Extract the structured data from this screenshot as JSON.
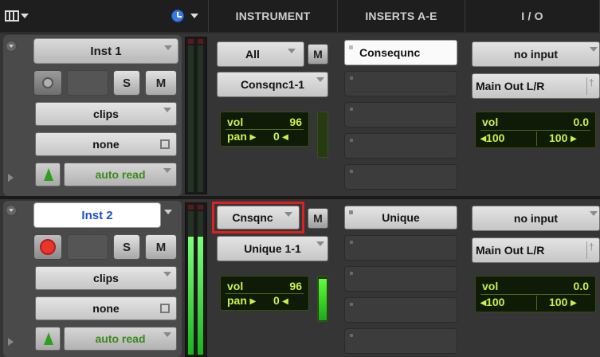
{
  "header": {
    "instrument": "INSTRUMENT",
    "inserts": "INSERTS A-E",
    "io": "I / O"
  },
  "tracks": [
    {
      "name": "Inst 1",
      "name_selected": false,
      "record_armed": false,
      "solo_label": "S",
      "mute_label": "M",
      "playlist": "clips",
      "group": "none",
      "automation": "auto read",
      "instrument_midi_in": "All",
      "instrument_midi_out": "Consqnc1-1",
      "instrument_m_label": "M",
      "vol_label": "vol",
      "vol_value": "96",
      "pan_label": "pan",
      "pan_value": "0",
      "insert_a": "Consequnc",
      "io_input": "no input",
      "io_output": "Main Out L/R",
      "io_vol_label": "vol",
      "io_vol_value": "0.0",
      "io_pan_left": "100",
      "io_pan_right": "100",
      "meter_level": 0
    },
    {
      "name": "Inst 2",
      "name_selected": true,
      "record_armed": true,
      "solo_label": "S",
      "mute_label": "M",
      "playlist": "clips",
      "group": "none",
      "automation": "auto read",
      "instrument_midi_in": "Cnsqnc",
      "instrument_midi_out": "Unique 1-1",
      "instrument_m_label": "M",
      "vol_label": "vol",
      "vol_value": "96",
      "pan_label": "pan",
      "pan_value": "0",
      "insert_a": "Unique",
      "io_input": "no input",
      "io_output": "Main Out L/R",
      "io_vol_label": "vol",
      "io_vol_value": "0.0",
      "io_pan_left": "100",
      "io_pan_right": "100",
      "meter_level": 0.78
    }
  ],
  "colors": {
    "record_red": "#e8352e",
    "highlight_frame": "#e02020",
    "green_text": "#c7f24a",
    "selected_name": "#1f4fd8"
  }
}
